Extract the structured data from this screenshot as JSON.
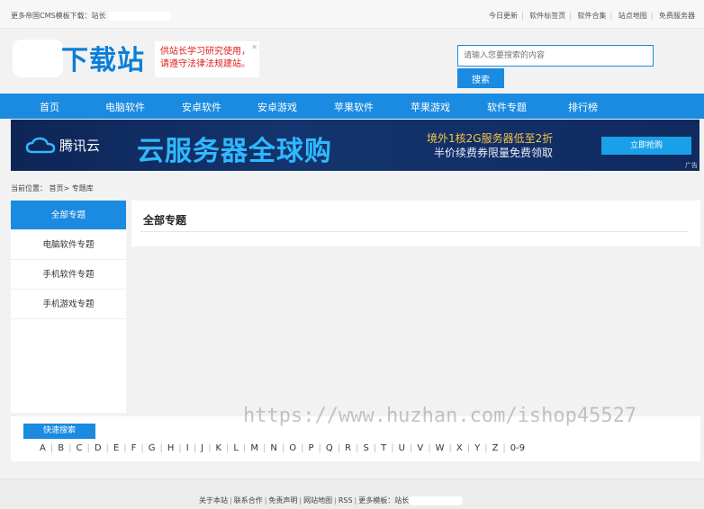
{
  "topbar": {
    "left_text": "更多帝国CMS模板下载：站长",
    "links": [
      "今日更新",
      "软件标签页",
      "软件合集",
      "站点地图",
      "免费服务器"
    ]
  },
  "header": {
    "logo_text": "下载站",
    "notice_line1": "供站长学习研究使用，",
    "notice_line2": "请遵守法律法规建站。",
    "search_placeholder": "请输入您要搜索的内容",
    "search_button": "搜索"
  },
  "nav": [
    "首页",
    "电脑软件",
    "安卓软件",
    "安卓游戏",
    "苹果软件",
    "苹果游戏",
    "软件专题",
    "排行榜"
  ],
  "banner": {
    "brand": "腾讯云",
    "headline": "云服务器全球购",
    "sub1": "境外1核2G服务器低至2折",
    "sub2": "半价续费券限量免费领取",
    "cta": "立即抢购",
    "ad_tag": "广告"
  },
  "breadcrumb": {
    "label": "当前位置：",
    "home": "首页",
    "sep": ">",
    "current": "专题库"
  },
  "sidebar": [
    "全部专题",
    "电脑软件专题",
    "手机软件专题",
    "手机游戏专题"
  ],
  "content": {
    "title": "全部专题"
  },
  "quick_search": {
    "title": "快速搜索",
    "letters": [
      "A",
      "B",
      "C",
      "D",
      "E",
      "F",
      "G",
      "H",
      "I",
      "J",
      "K",
      "L",
      "M",
      "N",
      "O",
      "P",
      "Q",
      "R",
      "S",
      "T",
      "U",
      "V",
      "W",
      "X",
      "Y",
      "Z",
      "0-9"
    ]
  },
  "watermark": "https://www.huzhan.com/ishop45527",
  "footer": {
    "links": [
      "关于本站",
      "联系合作",
      "免责声明",
      "网站地图",
      "RSS",
      "更多模板：站长"
    ]
  },
  "colors": {
    "accent": "#1a8be0",
    "notice_text": "#e02020",
    "banner_bg": "#102a60",
    "banner_headline": "#2fb8ff"
  }
}
